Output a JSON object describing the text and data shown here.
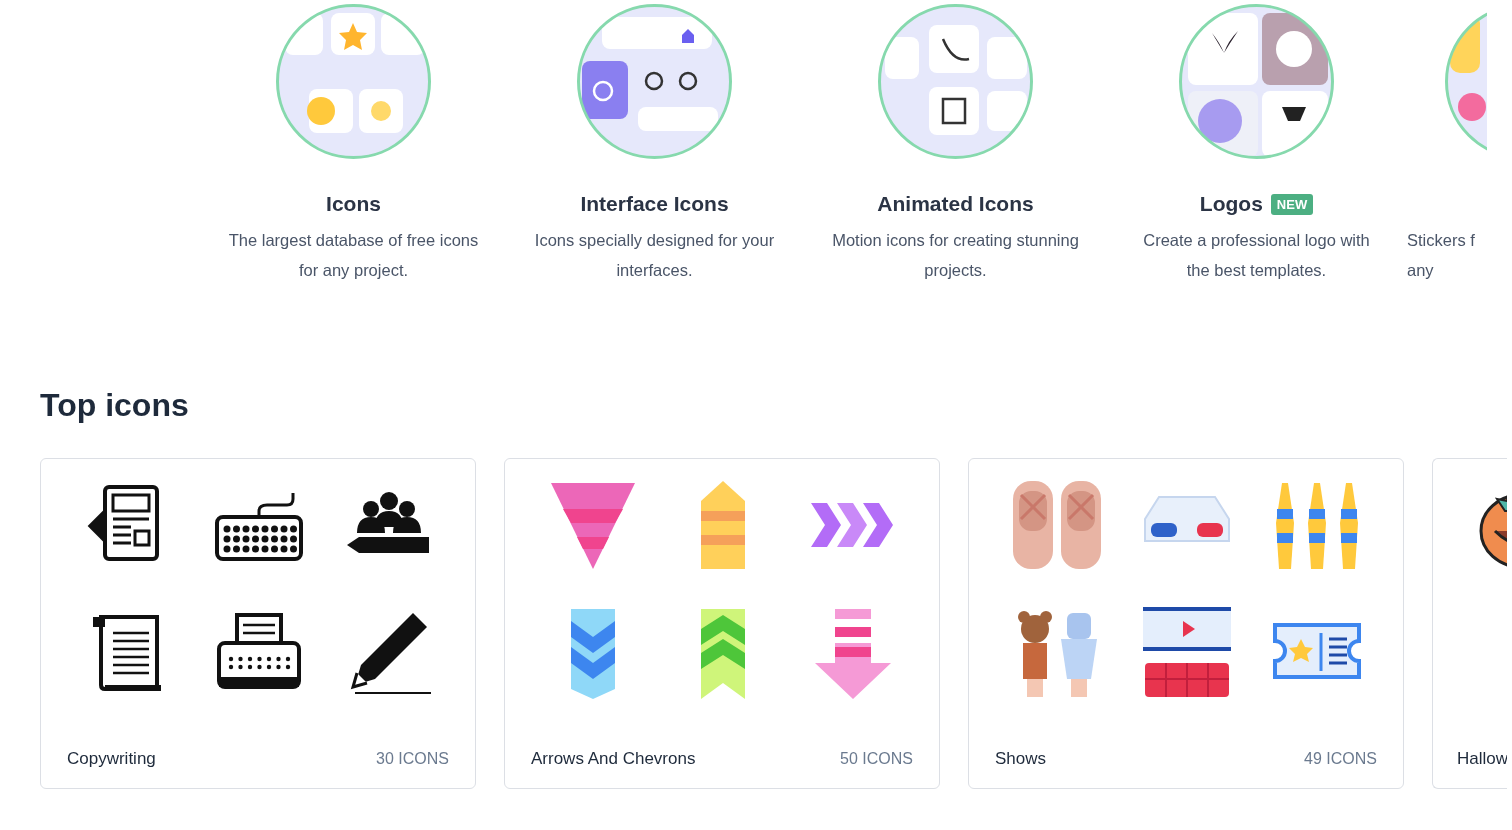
{
  "categories": [
    {
      "title": "Icons",
      "description": "The largest database of free icons for any project."
    },
    {
      "title": "Interface Icons",
      "description": "Icons specially designed for your interfaces."
    },
    {
      "title": "Animated Icons",
      "description": "Motion icons for creating stunning projects."
    },
    {
      "title": "Logos",
      "badge": "NEW",
      "description": "Create a professional logo with the best templates."
    },
    {
      "description": "Stickers f any"
    }
  ],
  "section_title": "Top icons",
  "packs": [
    {
      "name": "Copywriting",
      "count": "30 ICONS"
    },
    {
      "name": "Arrows And Chevrons",
      "count": "50 ICONS"
    },
    {
      "name": "Shows",
      "count": "49 ICONS"
    },
    {
      "name": "Hallow"
    }
  ]
}
